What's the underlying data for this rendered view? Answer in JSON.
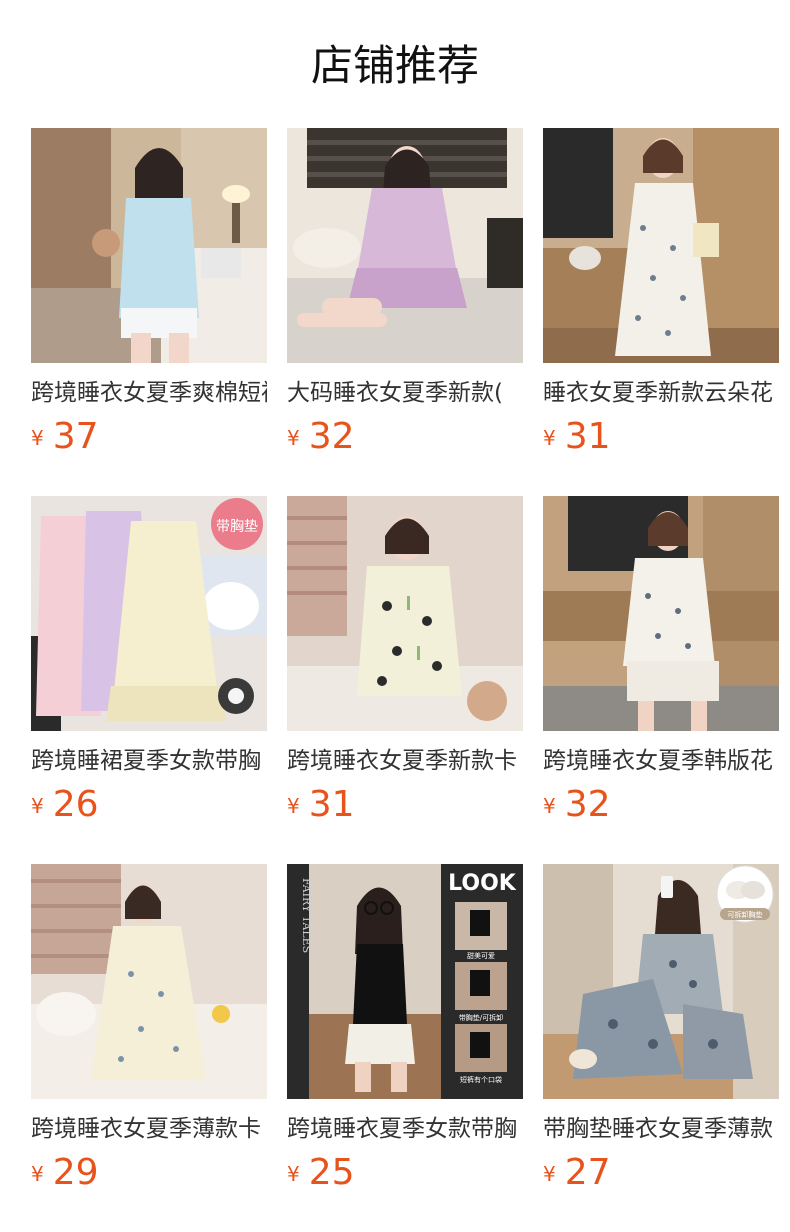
{
  "header": {
    "title": "店铺推荐"
  },
  "products": [
    {
      "name": "跨境睡衣女夏季爽棉短袖",
      "currency": "¥",
      "price": "37",
      "image": "pajama-blue-short-set-photo"
    },
    {
      "name": "大码睡衣女夏季新款(",
      "currency": "¥",
      "price": "32",
      "image": "pajama-pink-dress-photo"
    },
    {
      "name": "睡衣女夏季新款云朵花",
      "currency": "¥",
      "price": "31",
      "image": "nightdress-white-print-photo"
    },
    {
      "name": "跨境睡裙夏季女款带胸",
      "currency": "¥",
      "price": "26",
      "image": "nightdress-three-colors-photo",
      "badge": "带胸垫"
    },
    {
      "name": "跨境睡衣女夏季新款卡",
      "currency": "¥",
      "price": "31",
      "image": "pajama-panda-print-photo"
    },
    {
      "name": "跨境睡衣女夏季韩版花",
      "currency": "¥",
      "price": "32",
      "image": "pajama-ruffle-set-photo"
    },
    {
      "name": "跨境睡衣女夏季薄款卡",
      "currency": "¥",
      "price": "29",
      "image": "nightdress-cream-floral-photo"
    },
    {
      "name": "跨境睡衣夏季女款带胸",
      "currency": "¥",
      "price": "25",
      "image": "camisole-black-set-photo",
      "look_title": "LOOK",
      "side_text": "FAIRY TALES",
      "look_captions": [
        "甜美可爱",
        "带胸垫/可拆卸",
        "短裤有个口袋"
      ]
    },
    {
      "name": "带胸垫睡衣女夏季薄款",
      "currency": "¥",
      "price": "27",
      "image": "pajama-toile-print-photo",
      "badge": "可拆卸胸垫"
    }
  ],
  "colors": {
    "price": "#e8531c",
    "title": "#111111",
    "product_name": "#333333"
  }
}
